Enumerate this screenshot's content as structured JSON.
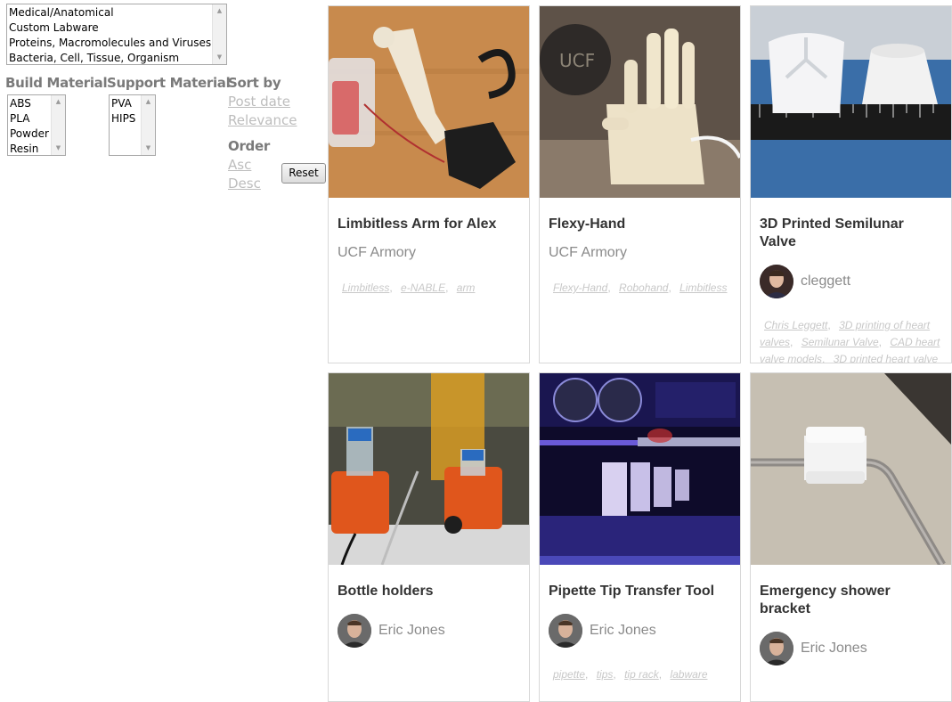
{
  "category_list": {
    "options": [
      "Medical/Anatomical",
      "Custom Labware",
      "Proteins, Macromolecules and Viruses",
      "Bacteria, Cell, Tissue, Organism"
    ]
  },
  "build_material": {
    "label": "Build Material",
    "options": [
      "ABS",
      "PLA",
      "Powder",
      "Resin"
    ]
  },
  "support_material": {
    "label": "Support Material",
    "options": [
      "PVA",
      "HIPS"
    ]
  },
  "sort": {
    "label": "Sort by",
    "post_date": "Post date",
    "relevance": "Relevance"
  },
  "order": {
    "label": "Order",
    "asc": "Asc",
    "desc": "Desc"
  },
  "reset_label": "Reset",
  "cards": [
    {
      "title": "Limbitless Arm for Alex",
      "author": "UCF Armory",
      "tags": [
        "Limbitless",
        "e-NABLE",
        "arm"
      ]
    },
    {
      "title": "Flexy-Hand",
      "author": "UCF Armory",
      "tags": [
        "Flexy-Hand",
        "Robohand",
        "Limbitless"
      ]
    },
    {
      "title": "3D Printed Semilunar Valve",
      "author": "cleggett",
      "tags": [
        "Chris Leggett",
        "3D printing of heart valves",
        "Semilunar Valve",
        "CAD heart valve models",
        "3D printed heart valve"
      ]
    },
    {
      "title": "Bottle holders",
      "author": "Eric Jones",
      "tags": []
    },
    {
      "title": "Pipette Tip Transfer Tool",
      "author": "Eric Jones",
      "tags": [
        "pipette",
        "tips",
        "tip rack",
        "labware"
      ]
    },
    {
      "title": "Emergency shower bracket",
      "author": "Eric Jones",
      "tags": []
    }
  ],
  "colors": {
    "label_gray": "#7a7a7a",
    "link_gray": "#bdbdbd",
    "card_border": "#d8d8d8",
    "title": "#333333",
    "author": "#8a8a8a"
  }
}
